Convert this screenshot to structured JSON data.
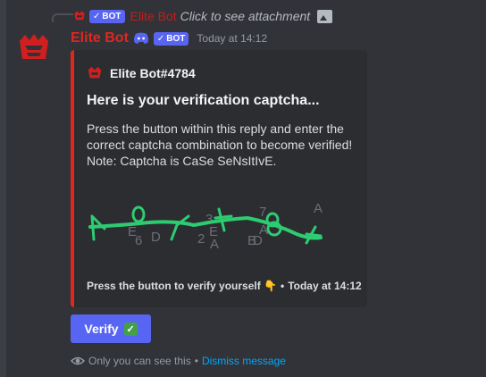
{
  "reply": {
    "badge": "BOT",
    "author": "Elite Bot",
    "text": "Click to see attachment",
    "attachment_icon": "image-icon"
  },
  "message": {
    "author": "Elite Bot",
    "badge": "BOT",
    "timestamp": "Today at 14:12",
    "author_color": "#e0261f"
  },
  "embed": {
    "author_name": "Elite Bot#4784",
    "title": "Here is your verification captcha...",
    "description_lines": [
      "Press the button within this reply and enter the",
      "correct captcha combination to become verified!",
      "Note: Captcha is CaSe SeNsItIvE."
    ],
    "captcha_text": "A0A1E8F",
    "captcha_noise": [
      "E",
      "6",
      "D",
      "3",
      "2",
      "A",
      "E",
      "B",
      "D",
      "A",
      "7",
      "A"
    ],
    "footer_text": "Press the button to verify yourself 👇",
    "footer_separator": "•",
    "footer_timestamp": "Today at 14:12",
    "accent_color": "#e0261f"
  },
  "button": {
    "label": "Verify",
    "emoji": "✓",
    "color": "#5865f2"
  },
  "ephemeral": {
    "text": "Only you can see this",
    "separator": "•",
    "dismiss": "Dismiss message"
  }
}
